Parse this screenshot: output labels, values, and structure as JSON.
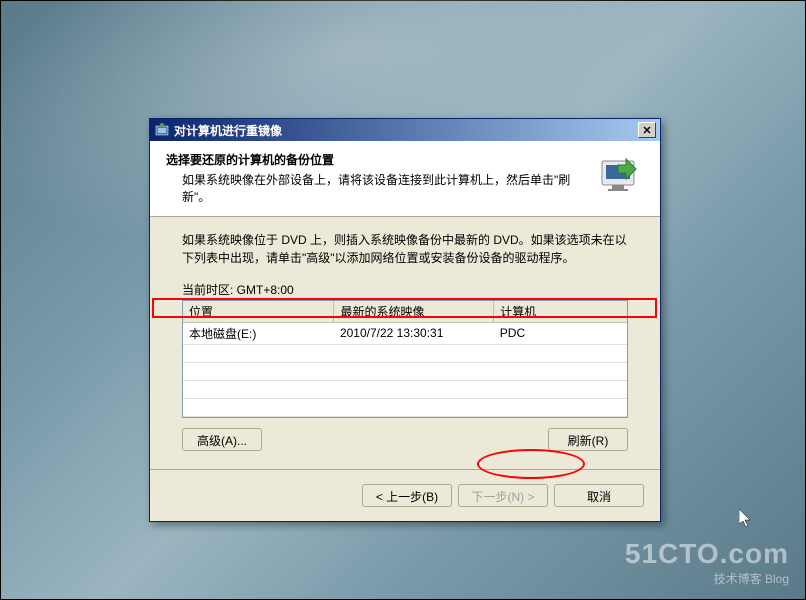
{
  "window": {
    "title": "对计算机进行重镜像"
  },
  "header": {
    "title": "选择要还原的计算机的备份位置",
    "description": "如果系统映像在外部设备上，请将该设备连接到此计算机上，然后单击\"刷新\"。"
  },
  "content": {
    "instructions": "如果系统映像位于 DVD 上，则插入系统映像备份中最新的 DVD。如果该选项未在以下列表中出现，请单击\"高级\"以添加网络位置或安装备份设备的驱动程序。",
    "timezone_label": "当前时区: GMT+8:00"
  },
  "table": {
    "columns": [
      "位置",
      "最新的系统映像",
      "计算机"
    ],
    "rows": [
      {
        "location": "本地磁盘(E:)",
        "latest_image": "2010/7/22 13:30:31",
        "computer": "PDC"
      }
    ]
  },
  "buttons": {
    "advanced": "高级(A)...",
    "refresh": "刷新(R)",
    "back": "< 上一步(B)",
    "next": "下一步(N) >",
    "cancel": "取消"
  },
  "watermark": {
    "main": "51CTO.com",
    "sub": "技术博客      Blog"
  }
}
